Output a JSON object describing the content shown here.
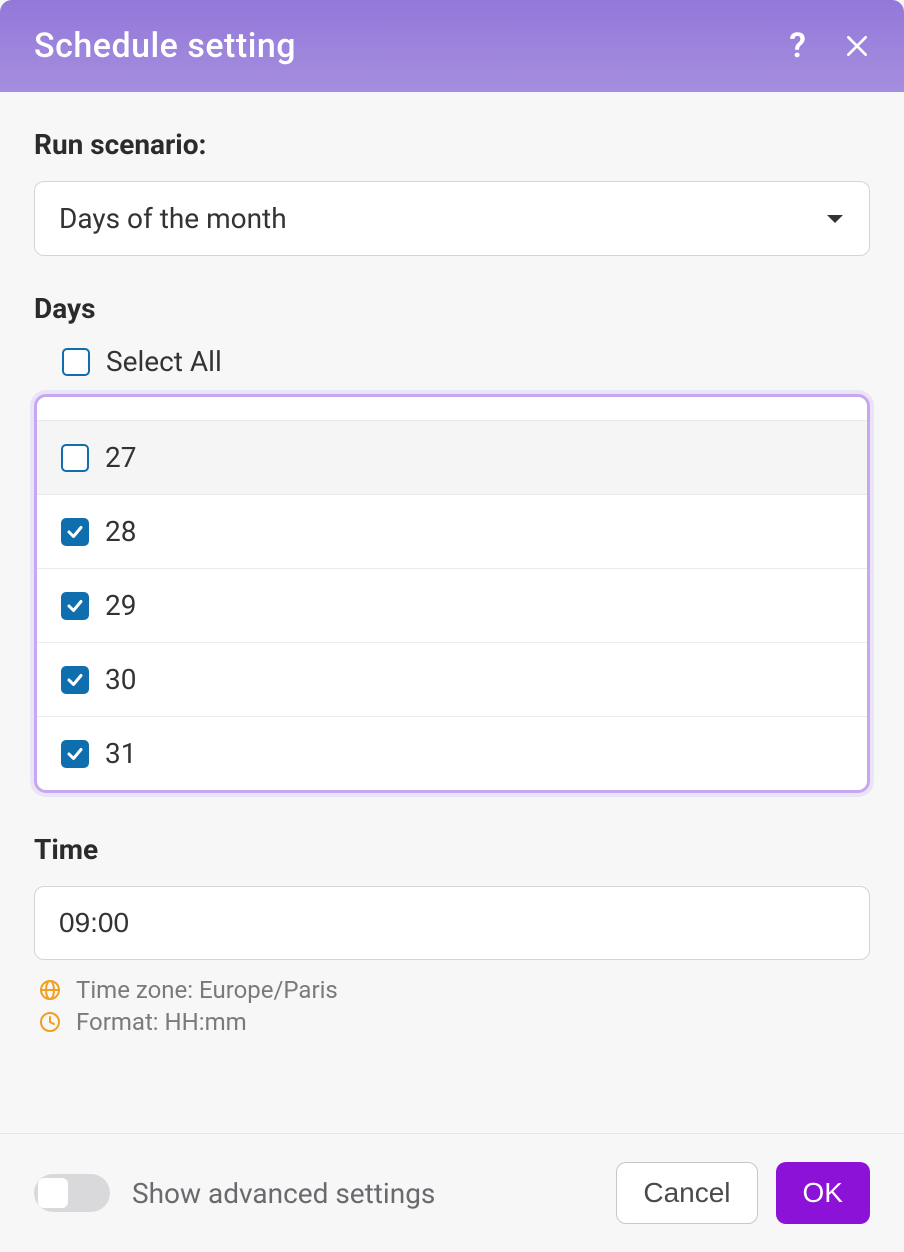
{
  "header": {
    "title": "Schedule setting"
  },
  "runScenario": {
    "label": "Run scenario:",
    "value": "Days of the month"
  },
  "days": {
    "label": "Days",
    "selectAllLabel": "Select All",
    "selectAllChecked": false,
    "items": [
      {
        "label": "27",
        "checked": false,
        "hover": true
      },
      {
        "label": "28",
        "checked": true,
        "hover": false
      },
      {
        "label": "29",
        "checked": true,
        "hover": false
      },
      {
        "label": "30",
        "checked": true,
        "hover": false
      },
      {
        "label": "31",
        "checked": true,
        "hover": false
      }
    ]
  },
  "time": {
    "label": "Time",
    "value": "09:00",
    "timezoneHint": "Time zone: Europe/Paris",
    "formatHint": "Format: HH:mm"
  },
  "footer": {
    "advancedLabel": "Show advanced settings",
    "advancedEnabled": false,
    "cancelLabel": "Cancel",
    "okLabel": "OK"
  }
}
